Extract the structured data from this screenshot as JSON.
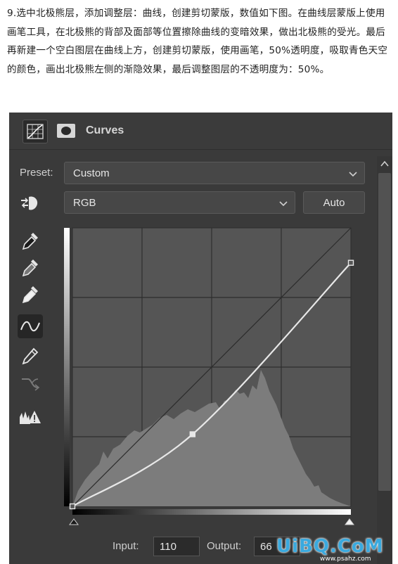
{
  "intro_text": "9.选中北极熊层，添加调整层：曲线，创建剪切蒙版，数值如下图。在曲线层蒙版上使用画笔工具，在北极熊的背部及面部等位置擦除曲线的变暗效果，做出北极熊的受光。最后再新建一个空白图层在曲线上方，创建剪切蒙版，使用画笔，50%透明度，吸取青色天空的颜色，画出北极熊左侧的渐隐效果，最后调整图层的不透明度为：50%。",
  "panel": {
    "title": "Curves",
    "header_icons": [
      "curves-icon",
      "mask-icon"
    ],
    "preset_label": "Preset:",
    "preset_value": "Custom",
    "channel_value": "RGB",
    "auto_label": "Auto",
    "tools": [
      "on-image-adjust-icon",
      "black-point-eyedropper-icon",
      "gray-point-eyedropper-icon",
      "white-point-eyedropper-icon",
      "curve-point-tool-icon",
      "pencil-icon",
      "smooth-curve-icon",
      "clipping-warning-icon"
    ],
    "active_tool": "curve-point-tool-icon",
    "input_label": "Input:",
    "input_value": "110",
    "output_label": "Output:",
    "output_value": "66"
  },
  "curve_points": [
    [
      0,
      0
    ],
    [
      110,
      66
    ],
    [
      255,
      223
    ]
  ],
  "watermark": {
    "text": "UiBQ.CoM",
    "url": "www.psahz.com"
  },
  "colors": {
    "panel_bg": "#3a3a3a",
    "graph_bg": "#555555",
    "histogram": "#7c7c7c",
    "curve": "#e8e8e8",
    "watermark": "#3aa9de"
  }
}
